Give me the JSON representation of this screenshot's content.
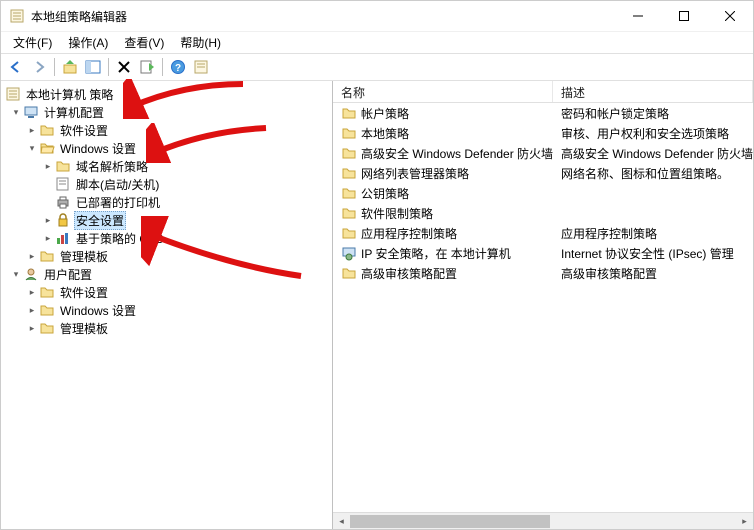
{
  "title": "本地组策略编辑器",
  "menu": {
    "file": "文件(F)",
    "action": "操作(A)",
    "view": "查看(V)",
    "help": "帮助(H)"
  },
  "tree": {
    "root": "本地计算机 策略",
    "computer_config": "计算机配置",
    "software_settings1": "软件设置",
    "windows_settings1": "Windows 设置",
    "dns_policy": "域名解析策略",
    "scripts": "脚本(启动/关机)",
    "printers": "已部署的打印机",
    "security_settings": "安全设置",
    "qos": "基于策略的 QoS",
    "admin_templates1": "管理模板",
    "user_config": "用户配置",
    "software_settings2": "软件设置",
    "windows_settings2": "Windows 设置",
    "admin_templates2": "管理模板"
  },
  "list": {
    "col_name": "名称",
    "col_desc": "描述",
    "rows": [
      {
        "name": "帐户策略",
        "desc": "密码和帐户锁定策略",
        "icon": "folder"
      },
      {
        "name": "本地策略",
        "desc": "审核、用户权利和安全选项策略",
        "icon": "folder"
      },
      {
        "name": "高级安全 Windows Defender 防火墙",
        "desc": "高级安全 Windows Defender 防火墙",
        "icon": "folder"
      },
      {
        "name": "网络列表管理器策略",
        "desc": "网络名称、图标和位置组策略。",
        "icon": "folder"
      },
      {
        "name": "公钥策略",
        "desc": "",
        "icon": "folder"
      },
      {
        "name": "软件限制策略",
        "desc": "",
        "icon": "folder"
      },
      {
        "name": "应用程序控制策略",
        "desc": "应用程序控制策略",
        "icon": "folder"
      },
      {
        "name": "IP 安全策略，在 本地计算机",
        "desc": "Internet 协议安全性 (IPsec) 管理",
        "icon": "ipsec"
      },
      {
        "name": "高级审核策略配置",
        "desc": "高级审核策略配置",
        "icon": "folder"
      }
    ]
  }
}
